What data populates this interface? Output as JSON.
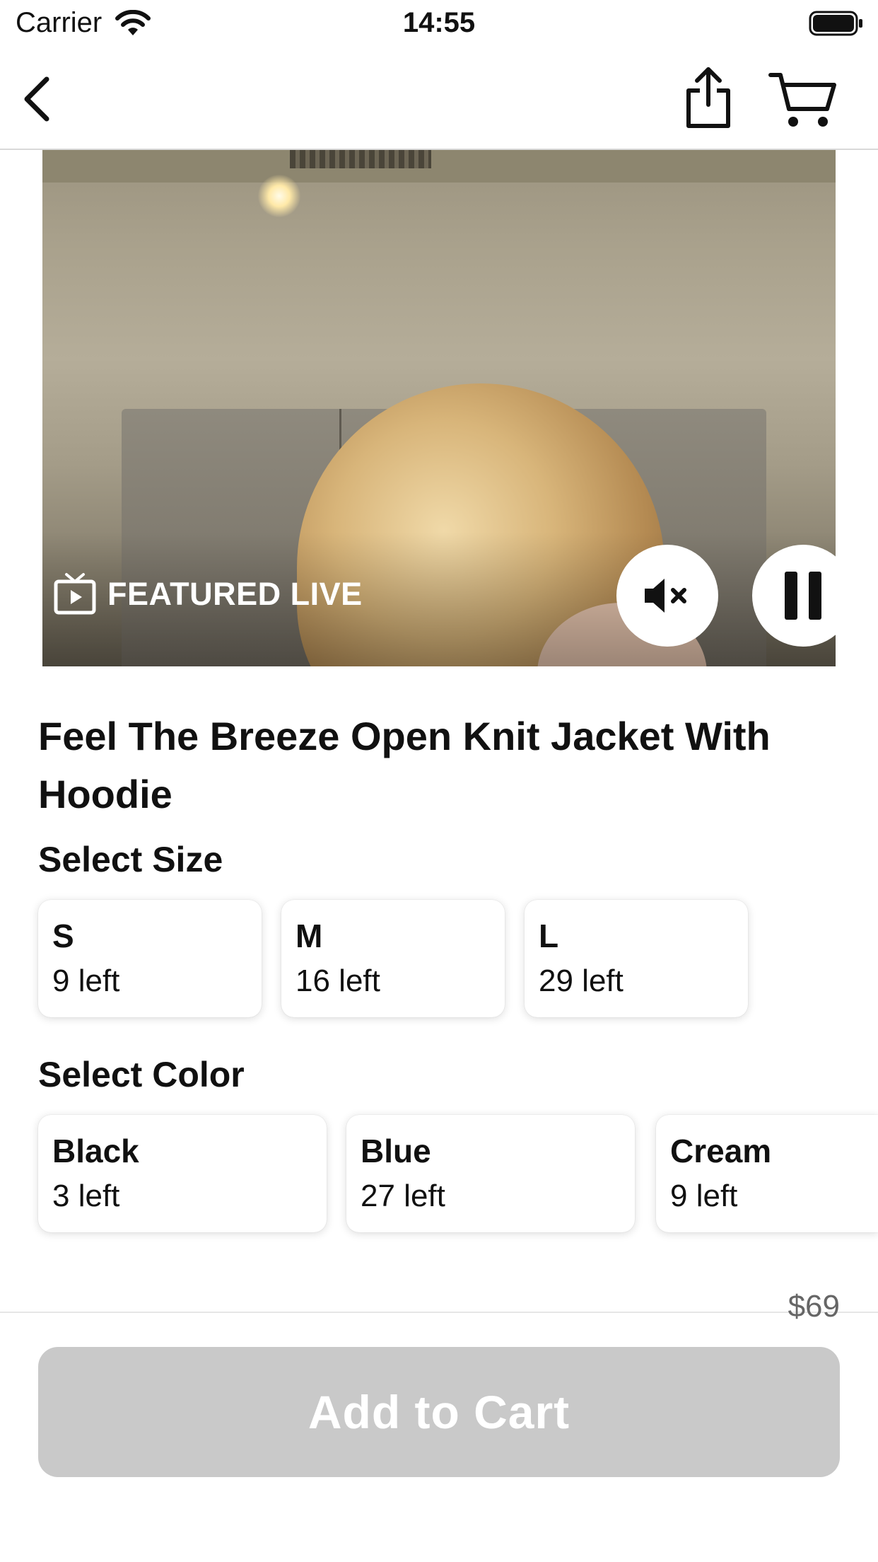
{
  "status_bar": {
    "carrier": "Carrier",
    "time": "14:55",
    "icons": [
      "wifi-icon",
      "battery-icon"
    ]
  },
  "nav": {
    "icons": [
      "back-chevron-icon",
      "share-icon",
      "cart-icon"
    ]
  },
  "video": {
    "badge_label": "FEATURED LIVE",
    "badge_icon": "tv-play-icon",
    "controls": [
      "mute-icon",
      "pause-icon"
    ]
  },
  "product": {
    "title": "Feel The Breeze Open Knit Jacket With Hoodie",
    "size_label": "Select Size",
    "sizes": [
      {
        "name": "S",
        "stock": "9 left"
      },
      {
        "name": "M",
        "stock": "16 left"
      },
      {
        "name": "L",
        "stock": "29 left"
      }
    ],
    "color_label": "Select Color",
    "colors": [
      {
        "name": "Black",
        "stock": "3 left"
      },
      {
        "name": "Blue",
        "stock": "27 left"
      },
      {
        "name": "Cream",
        "stock": "9 left"
      }
    ],
    "price": "$69",
    "add_to_cart_label": "Add to Cart"
  },
  "theme": {
    "button_disabled_color": "#c9c9c9",
    "text_color": "#111111",
    "price_color": "#666666"
  }
}
